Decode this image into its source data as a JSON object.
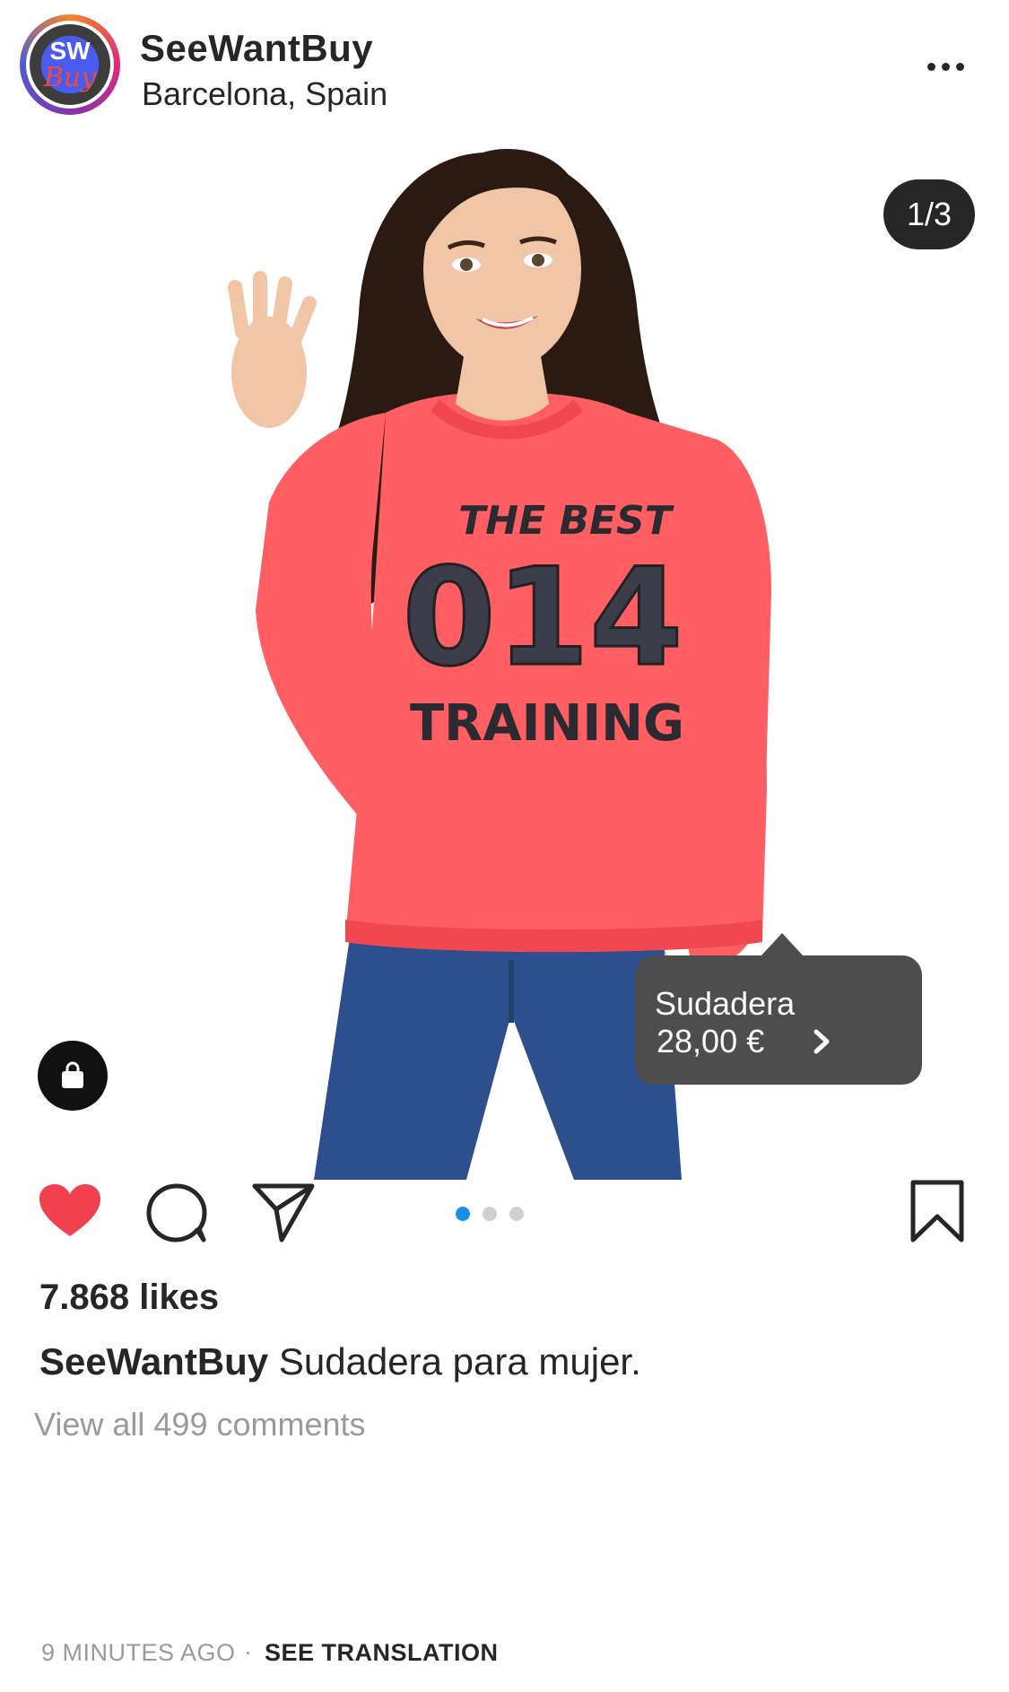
{
  "header": {
    "avatar_top_text": "SW",
    "avatar_bottom_text": "Buy",
    "username": "SeeWantBuy",
    "location": "Barcelona, Spain"
  },
  "media": {
    "counter": "1/3",
    "shirt_text": [
      "THE BEST",
      "014",
      "TRAINING"
    ],
    "product_tag": {
      "name": "Sudadera",
      "price": "28,00 €"
    },
    "colors": {
      "sweater": "#ff5e62",
      "jeans": "#2d4f8e",
      "hair": "#2a1a12",
      "skin": "#f1c6a6"
    }
  },
  "actions": {
    "liked": true,
    "carousel": {
      "total": 3,
      "active_index": 0
    }
  },
  "post": {
    "likes": "7.868 likes",
    "caption_user": "SeeWantBuy",
    "caption_text": "Sudadera para mujer.",
    "view_comments": "View all 499 comments",
    "time": "9 MINUTES AGO",
    "separator": "·",
    "see_translation": "SEE TRANSLATION"
  },
  "colors": {
    "like_red": "#f2404f",
    "dot_active": "#1a8fe8",
    "dark_pill": "#262626"
  }
}
